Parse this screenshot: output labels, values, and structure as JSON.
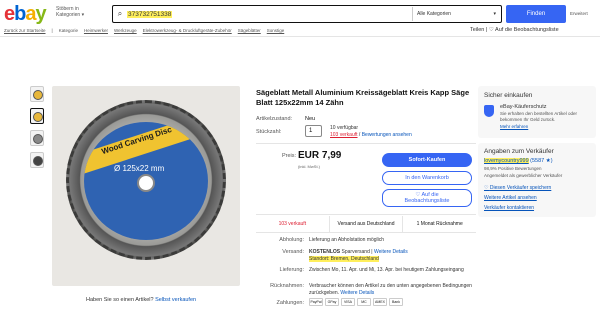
{
  "header": {
    "logo": [
      "e",
      "b",
      "a",
      "y"
    ],
    "browse_label": "Stöbern in Kategorien",
    "search_value": "373732751338",
    "category_select": "Alle Kategorien",
    "find_button": "Finden",
    "advanced_link": "Erweitert"
  },
  "breadcrumb": {
    "items": [
      "Zurück zur Startseite",
      "Kategorie",
      "Heimwerker",
      "Werkzeuge",
      "Elektrowerkzeug- & Druckluftgeräte-Zubehör",
      "Sägeblätter",
      "Sonstige"
    ],
    "share": "Teilen",
    "watchlist": "Auf die Beobachtungsliste"
  },
  "product": {
    "title": "Sägeblatt Metall Aluminium Kreissägeblatt Kreis Kapp Säge Blatt 125x22mm 14 Zähn",
    "condition_label": "Artikelzustand:",
    "condition_value": "Neu",
    "qty_label": "Stückzahl:",
    "qty_value": "1",
    "available": "10 verfügbar",
    "sold_count_link": "103 verkauft",
    "ratings_link": "Bewertungen ansehen",
    "price_label": "Preis:",
    "price": "EUR 7,99",
    "price_sub": "(inkl. MwSt.)",
    "image_label_line1": "Wood Carving Disc",
    "image_label_line2": "Ø 125x22 mm",
    "sell_prompt": "Haben Sie so einen Artikel?",
    "sell_link": "Selbst verkaufen"
  },
  "buttons": {
    "buy_now": "Sofort-Kaufen",
    "add_to_cart": "In den Warenkorb",
    "watch_line1": "Auf die",
    "watch_line2": "Beobachtungsliste"
  },
  "stats": {
    "sold": "103 verkauft",
    "shipping": "Versand aus Deutschland",
    "returns": "1 Monat Rücknahme"
  },
  "details": {
    "pickup_label": "Abholung:",
    "pickup_value": "Lieferung an Abholstation möglich",
    "shipping_label": "Versand:",
    "shipping_value": "KOSTENLOS",
    "shipping_method": "Sparversand",
    "shipping_link": "Weitere Details",
    "location": "Standort: Bremen, Deutschland",
    "delivery_label": "Lieferung:",
    "delivery_value": "Zwischen Mo, 11. Apr. und Mi, 13. Apr. bei heutigem Zahlungseingang",
    "returns_label": "Rücknahmen:",
    "returns_value": "Verbraucher können den Artikel zu den unten angegebenen Bedingungen zurückgeben.",
    "returns_link": "Weitere Details",
    "payments_label": "Zahlungen:",
    "payment_methods": [
      "PayPal",
      "GPay",
      "VISA",
      "MC",
      "AMEX",
      "Bank"
    ]
  },
  "buyer_protection": {
    "heading": "Sicher einkaufen",
    "name": "eBay-Käuferschutz",
    "description": "Sie erhalten den bestellten Artikel oder bekommen Ihr Geld zurück.",
    "more_link": "Mehr erfahren"
  },
  "seller": {
    "heading": "Angaben zum Verkäufer",
    "username": "lovemycountry999",
    "score": "(5587 ★)",
    "feedback": "98,9% Positive Bewertungen",
    "type": "Angemeldet als gewerblicher Verkäufer",
    "save_link": "Diesen Verkäufer speichern",
    "other_items_link": "Weitere Artikel ansehen",
    "contact_link": "Verkäufer kontaktieren"
  },
  "colors": {
    "brand_blue": "#3665f3",
    "link_blue": "#0654ba",
    "highlight": "#ffef5c",
    "sold_red": "#dd1e31"
  }
}
